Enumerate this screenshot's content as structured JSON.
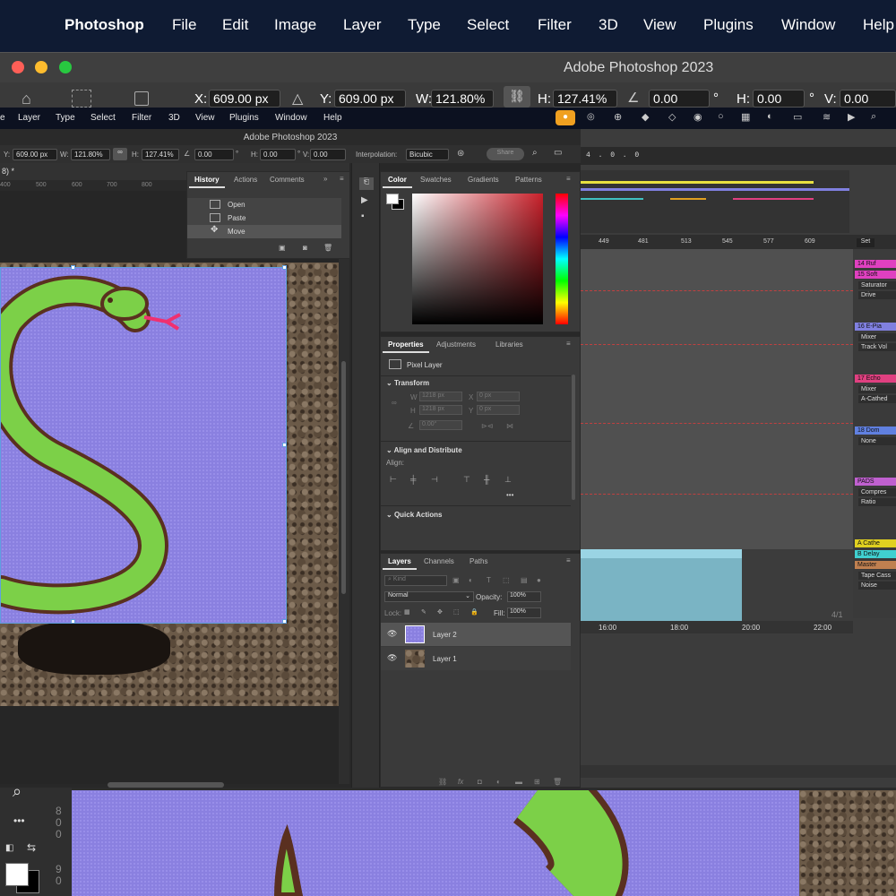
{
  "mac_menu": {
    "app": "Photoshop",
    "items": [
      "File",
      "Edit",
      "Image",
      "Layer",
      "Type",
      "Select",
      "Filter",
      "3D",
      "View",
      "Plugins",
      "Window",
      "Help"
    ]
  },
  "outer_window": {
    "title": "Adobe Photoshop 2023",
    "x_label": "X:",
    "x_value": "609.00 px",
    "y_label": "Y:",
    "y_value": "609.00 px",
    "w_label": "W:",
    "w_value": "121.80%",
    "h_label": "H:",
    "h_value": "127.41%",
    "angle_value": "0.00",
    "deg": "°",
    "hskew_label": "H:",
    "hskew_value": "0.00",
    "vskew_label": "V:",
    "vskew_value": "0.00"
  },
  "inner_menu": [
    "e",
    "Layer",
    "Type",
    "Select",
    "Filter",
    "3D",
    "View",
    "Plugins",
    "Window",
    "Help"
  ],
  "inner_window": {
    "title": "Adobe Photoshop 2023",
    "y_label": "Y:",
    "y_value": "609.00 px",
    "w_label": "W:",
    "w_value": "121.80%",
    "h_label": "H:",
    "h_value": "127.41%",
    "angle_value": "0.00",
    "deg": "°",
    "hskew_label": "H:",
    "hskew_value": "0.00",
    "vskew_label": "V:",
    "vskew_value": "0.00",
    "interp_label": "Interpolation:",
    "interp_value": "Bicubic",
    "share_label": "Share",
    "doc_tab": "8) *",
    "ruler": [
      "400",
      "500",
      "600",
      "700",
      "800"
    ]
  },
  "history": {
    "tabs": [
      "History",
      "Actions",
      "Comments"
    ],
    "items": [
      "Open",
      "Paste",
      "Move"
    ]
  },
  "color_panel": {
    "tabs": [
      "Color",
      "Swatches",
      "Gradients",
      "Patterns"
    ],
    "accent": "#c8202a"
  },
  "properties": {
    "tabs": [
      "Properties",
      "Adjustments",
      "Libraries"
    ],
    "kind": "Pixel Layer",
    "transform": "Transform",
    "w_label": "W",
    "w_value": "1218 px",
    "x_label": "X",
    "x_value": "0 px",
    "h_label": "H",
    "h_value": "1218 px",
    "y_label": "Y",
    "y_value": "0 px",
    "angle": "0.00°",
    "align_title": "Align and Distribute",
    "align_label": "Align:",
    "more": "•••",
    "quick": "Quick Actions"
  },
  "layers": {
    "tabs": [
      "Layers",
      "Channels",
      "Paths"
    ],
    "kind_placeholder": "Kind",
    "blend": "Normal",
    "opacity_label": "Opacity:",
    "opacity": "100%",
    "lock_label": "Lock:",
    "fill_label": "Fill:",
    "fill": "100%",
    "items": [
      "Layer 2",
      "Layer 1"
    ]
  },
  "ableton": {
    "counter": "4 . 0 . 0",
    "ruler": [
      "449",
      "481",
      "513",
      "545",
      "577",
      "609"
    ],
    "set_label": "Set",
    "time": [
      "16:00",
      "18:00",
      "20:00",
      "22:00"
    ],
    "sig": "4/1",
    "tracks": [
      {
        "name": "14 Ruf",
        "color": "#e040c0",
        "devices": []
      },
      {
        "name": "15 Soft",
        "color": "#e040c0",
        "devices": [
          "Saturator",
          "Drive"
        ]
      },
      {
        "name": "16 E-Pia",
        "color": "#8080e0",
        "devices": [
          "Mixer",
          "Track Vol"
        ]
      },
      {
        "name": "17 Echo",
        "color": "#e04080",
        "devices": [
          "Mixer",
          "A-Cathed"
        ]
      },
      {
        "name": "18 Dom",
        "color": "#6080e0",
        "devices": [
          "None"
        ]
      },
      {
        "name": "PADS",
        "color": "#c060d0",
        "devices": [
          "Compres",
          "Ratio"
        ]
      },
      {
        "name": "A Cathe",
        "color": "#e0d020",
        "devices": []
      },
      {
        "name": "B Delay",
        "color": "#40d0d0",
        "devices": []
      },
      {
        "name": "Master",
        "color": "#c08050",
        "devices": [
          "Tape Cass",
          "Noise"
        ]
      }
    ]
  },
  "bottom": {
    "ruler": [
      "8",
      "0",
      "0",
      "9",
      "0"
    ],
    "more": "•••"
  }
}
